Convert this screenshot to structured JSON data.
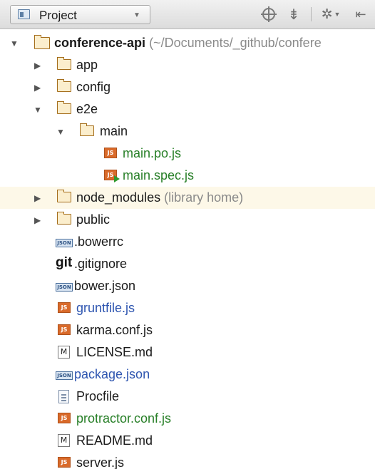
{
  "toolbar": {
    "view_label": "Project",
    "icons": [
      "project-icon",
      "locate-icon",
      "collapse-all-icon",
      "gear-icon",
      "hide-panel-icon"
    ]
  },
  "tree": {
    "root": {
      "name": "conference-api",
      "path": "(~/Documents/_github/confere"
    },
    "items": [
      {
        "name": "app",
        "kind": "folder",
        "expanded": false
      },
      {
        "name": "config",
        "kind": "folder",
        "expanded": false
      },
      {
        "name": "e2e",
        "kind": "folder",
        "expanded": true
      },
      {
        "name": "main",
        "kind": "folder",
        "expanded": true
      },
      {
        "name": "main.po.js",
        "kind": "js",
        "color": "green"
      },
      {
        "name": "main.spec.js",
        "kind": "js-spec",
        "color": "green"
      },
      {
        "name": "node_modules",
        "hint": "(library home)",
        "kind": "folder",
        "expanded": false
      },
      {
        "name": "public",
        "kind": "folder",
        "expanded": false
      },
      {
        "name": ".bowerrc",
        "kind": "json"
      },
      {
        "name": ".gitignore",
        "kind": "git"
      },
      {
        "name": "bower.json",
        "kind": "json"
      },
      {
        "name": "gruntfile.js",
        "kind": "js",
        "color": "blue"
      },
      {
        "name": "karma.conf.js",
        "kind": "js"
      },
      {
        "name": "LICENSE.md",
        "kind": "md"
      },
      {
        "name": "package.json",
        "kind": "json",
        "color": "blue"
      },
      {
        "name": "Procfile",
        "kind": "text"
      },
      {
        "name": "protractor.conf.js",
        "kind": "js",
        "color": "green"
      },
      {
        "name": "README.md",
        "kind": "md"
      },
      {
        "name": "server.js",
        "kind": "js"
      }
    ],
    "glyphs": {
      "js": "JS",
      "json": "JSON",
      "git": "git",
      "md": "M"
    }
  },
  "colors": {
    "green_file": "#277f27",
    "blue_file": "#2e55b0",
    "highlight_row": "#fdf8e8",
    "folder": "#a46d1b"
  }
}
